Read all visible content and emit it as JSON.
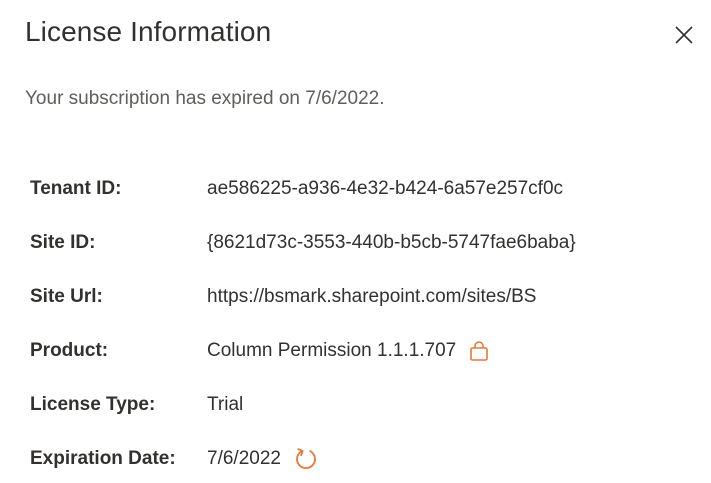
{
  "dialog": {
    "title": "License Information",
    "message": "Your subscription has expired on 7/6/2022.",
    "close_icon": "close-icon"
  },
  "fields": {
    "tenant_id": {
      "label": "Tenant ID:",
      "value": "ae586225-a936-4e32-b424-6a57e257cf0c"
    },
    "site_id": {
      "label": "Site ID:",
      "value": "{8621d73c-3553-440b-b5cb-5747fae6baba}"
    },
    "site_url": {
      "label": "Site Url:",
      "value": "https://bsmark.sharepoint.com/sites/BS"
    },
    "product": {
      "label": "Product:",
      "value": "Column Permission 1.1.1.707",
      "icon": "shopping-bag-icon"
    },
    "license_type": {
      "label": "License Type:",
      "value": "Trial"
    },
    "expiration_date": {
      "label": "Expiration Date:",
      "value": "7/6/2022",
      "icon": "refresh-icon"
    }
  },
  "colors": {
    "accent": "#e8773a",
    "text": "#323130",
    "muted_text": "#605e5c"
  }
}
